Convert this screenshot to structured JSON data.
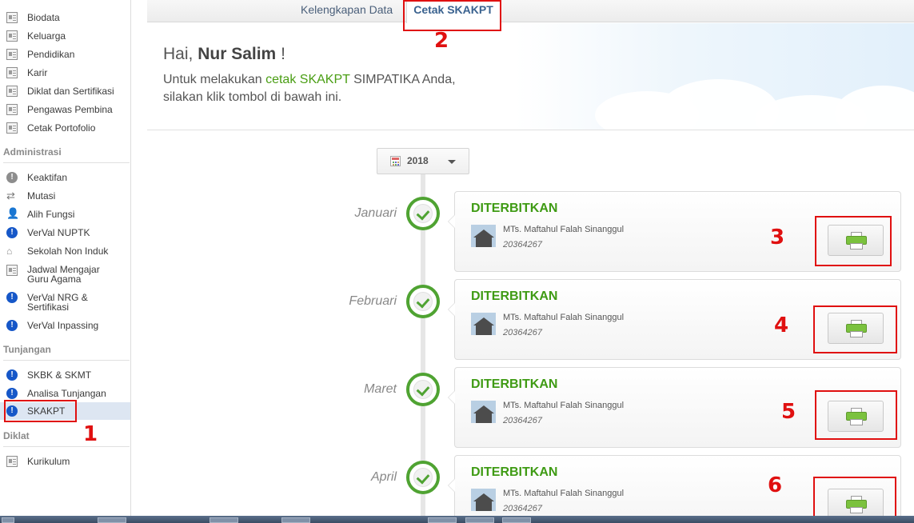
{
  "sidebar": {
    "items_top": [
      {
        "label": "Biodata",
        "icon": "document-icon"
      },
      {
        "label": "Keluarga",
        "icon": "document-icon"
      },
      {
        "label": "Pendidikan",
        "icon": "document-icon"
      },
      {
        "label": "Karir",
        "icon": "document-icon"
      },
      {
        "label": "Diklat dan Sertifikasi",
        "icon": "document-icon"
      },
      {
        "label": "Pengawas Pembina",
        "icon": "document-icon"
      },
      {
        "label": "Cetak Portofolio",
        "icon": "document-icon"
      }
    ],
    "section_administrasi": "Administrasi",
    "items_admin": [
      {
        "label": "Keaktifan",
        "icon": "info-grey-icon"
      },
      {
        "label": "Mutasi",
        "icon": "transfer-icon"
      },
      {
        "label": "Alih Fungsi",
        "icon": "user-icon"
      },
      {
        "label": "VerVal NUPTK",
        "icon": "info-icon"
      },
      {
        "label": "Sekolah Non Induk",
        "icon": "school-icon"
      },
      {
        "label": "Jadwal Mengajar Guru Agama",
        "icon": "document-icon"
      },
      {
        "label": "VerVal NRG & Sertifikasi",
        "icon": "info-icon"
      },
      {
        "label": "VerVal Inpassing",
        "icon": "info-icon"
      }
    ],
    "section_tunjangan": "Tunjangan",
    "items_tunjangan": [
      {
        "label": "SKBK & SKMT",
        "icon": "info-icon"
      },
      {
        "label": "Analisa Tunjangan",
        "icon": "info-icon"
      },
      {
        "label": "SKAKPT",
        "icon": "info-icon"
      }
    ],
    "section_diklat": "Diklat",
    "items_diklat": [
      {
        "label": "Kurikulum",
        "icon": "document-icon"
      }
    ]
  },
  "tabs": [
    {
      "label": "Kelengkapan Data"
    },
    {
      "label": "Cetak SKAKPT"
    }
  ],
  "hero": {
    "greeting_prefix": "Hai,",
    "user_name": "Nur Salim",
    "greeting_suffix": "!",
    "line1_part1": "Untuk melakukan",
    "line1_green1": "cetak",
    "line1_green2": "SKAKPT",
    "line1_part2": "SIMPATIKA Anda,",
    "line2": "silakan klik tombol di bawah ini."
  },
  "year_select": {
    "value": "2018"
  },
  "timeline": [
    {
      "month": "Januari",
      "status": "DITERBITKAN",
      "school": "MTs. Maftahul Falah Sinanggul",
      "id": "20364267"
    },
    {
      "month": "Februari",
      "status": "DITERBITKAN",
      "school": "MTs. Maftahul Falah Sinanggul",
      "id": "20364267"
    },
    {
      "month": "Maret",
      "status": "DITERBITKAN",
      "school": "MTs. Maftahul Falah Sinanggul",
      "id": "20364267"
    },
    {
      "month": "April",
      "status": "DITERBITKAN",
      "school": "MTs. Maftahul Falah Sinanggul",
      "id": "20364267"
    }
  ],
  "annotations": [
    "1",
    "2",
    "3",
    "4",
    "5",
    "6"
  ],
  "colors": {
    "status_green": "#3f9b14",
    "annotation_red": "#e01010",
    "info_blue": "#1657c8",
    "active_bg": "#dde6f2"
  }
}
